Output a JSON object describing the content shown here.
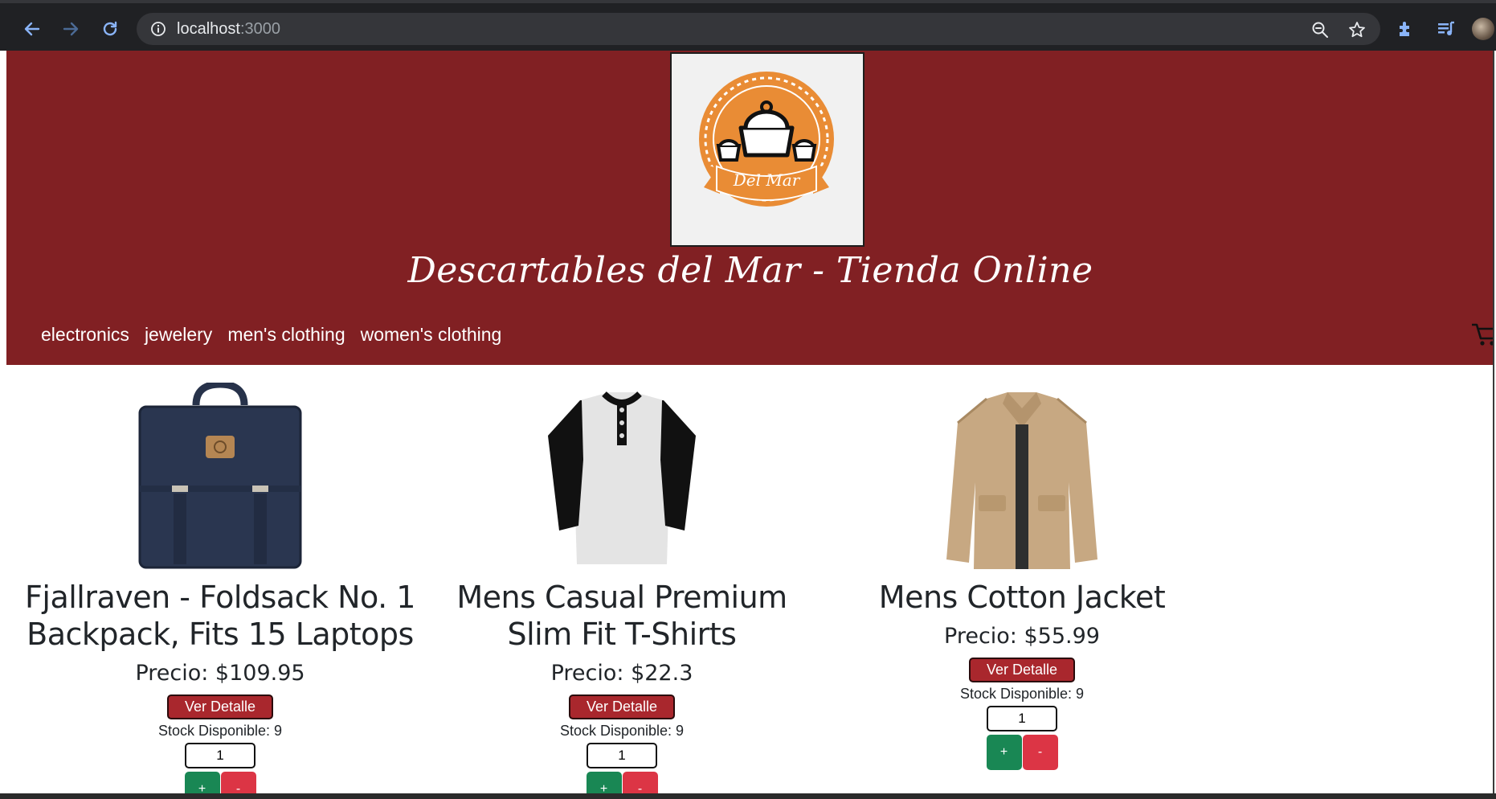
{
  "browser": {
    "url_host": "localhost",
    "url_port": ":3000"
  },
  "site": {
    "logo_text": "Del Mar",
    "title": "Descartables del Mar - Tienda Online",
    "categories": [
      "electronics",
      "jewelery",
      "men's clothing",
      "women's clothing"
    ]
  },
  "products": [
    {
      "name": "Fjallraven - Foldsack No. 1 Backpack, Fits 15 Laptops",
      "price": "Precio: $109.95",
      "detail_label": "Ver Detalle",
      "stock": "Stock Disponible: 9",
      "qty": "1",
      "plus": "+",
      "minus": "-"
    },
    {
      "name": "Mens Casual Premium Slim Fit T-Shirts",
      "price": "Precio: $22.3",
      "detail_label": "Ver Detalle",
      "stock": "Stock Disponible: 9",
      "qty": "1",
      "plus": "+",
      "minus": "-"
    },
    {
      "name": "Mens Cotton Jacket",
      "price": "Precio: $55.99",
      "detail_label": "Ver Detalle",
      "stock": "Stock Disponible: 9",
      "qty": "1",
      "plus": "+",
      "minus": "-"
    }
  ],
  "colors": {
    "header_bg": "#812023",
    "detail_button": "#a9272d",
    "plus_button": "#198754",
    "minus_button": "#dc3545"
  },
  "icons": [
    "back-icon",
    "forward-icon",
    "reload-icon",
    "info-icon",
    "zoom-icon",
    "star-icon",
    "extensions-icon",
    "media-icon",
    "profile-avatar",
    "cart-icon"
  ]
}
